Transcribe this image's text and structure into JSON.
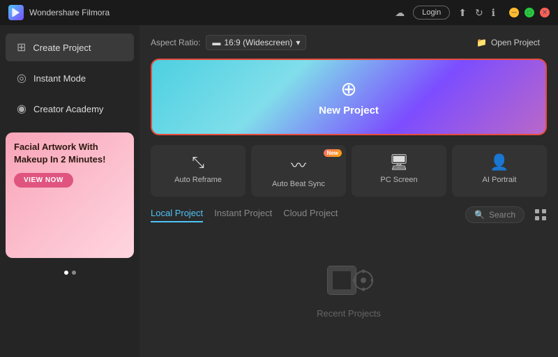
{
  "app": {
    "title": "Wondershare Filmora",
    "icon_label": "W"
  },
  "titlebar": {
    "login_label": "Login",
    "icons": [
      "cloud",
      "upload",
      "info",
      "close"
    ]
  },
  "sidebar": {
    "items": [
      {
        "id": "create-project",
        "label": "Create Project",
        "icon": "➕",
        "active": true
      },
      {
        "id": "instant-mode",
        "label": "Instant Mode",
        "icon": "⚡"
      },
      {
        "id": "creator-academy",
        "label": "Creator Academy",
        "icon": "🎓"
      }
    ],
    "ad": {
      "title": "Facial Artwork With Makeup In 2 Minutes!",
      "button_label": "VIEW NOW"
    },
    "dots": [
      true,
      false
    ]
  },
  "content": {
    "aspect_ratio_label": "Aspect Ratio:",
    "aspect_ratio_value": "16:9 (Widescreen)",
    "open_project_label": "Open Project",
    "new_project_label": "New Project",
    "features": [
      {
        "id": "auto-reframe",
        "label": "Auto Reframe",
        "icon": "⤢",
        "badge": null
      },
      {
        "id": "auto-beat-sync",
        "label": "Auto Beat Sync",
        "icon": "〰",
        "badge": "New"
      },
      {
        "id": "pc-screen",
        "label": "PC Screen",
        "icon": "🖥",
        "badge": null
      },
      {
        "id": "ai-portrait",
        "label": "AI Portrait",
        "icon": "👤",
        "badge": null
      }
    ],
    "tabs": [
      {
        "id": "local-project",
        "label": "Local Project",
        "active": true
      },
      {
        "id": "instant-project",
        "label": "Instant Project",
        "active": false
      },
      {
        "id": "cloud-project",
        "label": "Cloud Project",
        "active": false
      }
    ],
    "search_placeholder": "Search",
    "empty_state_text": "Recent Projects"
  }
}
